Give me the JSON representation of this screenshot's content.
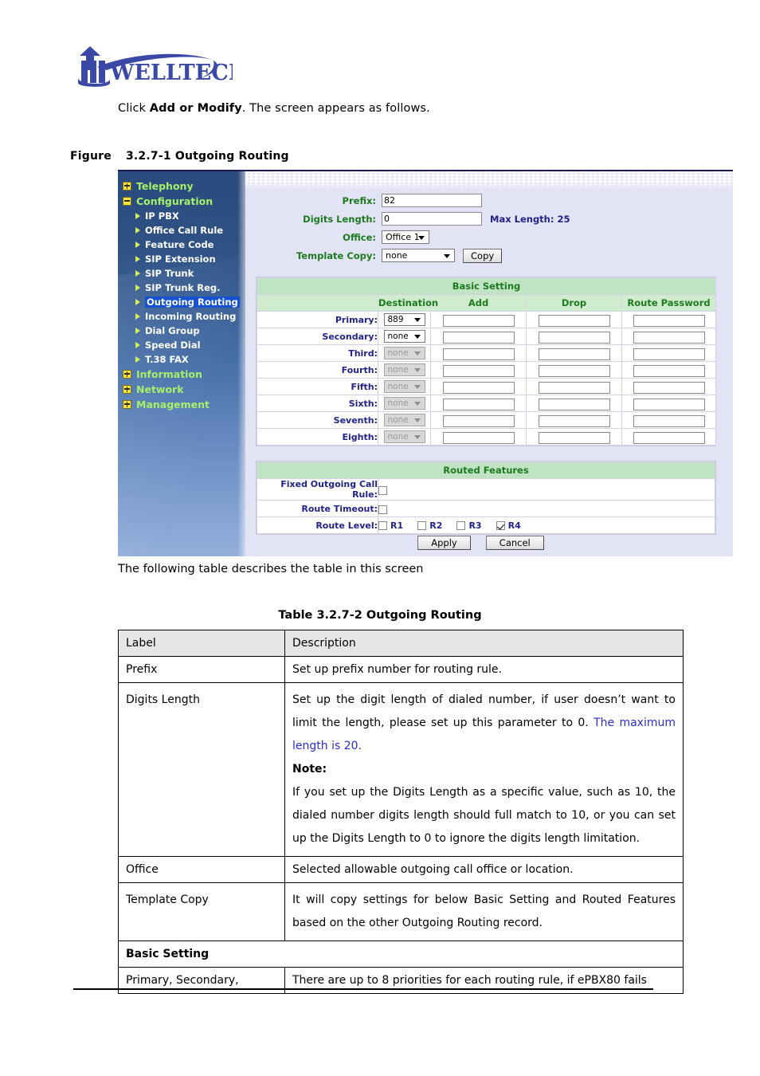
{
  "brand": {
    "name": "WELLTECH",
    "color": "#3a48a6"
  },
  "intro": {
    "before": "Click ",
    "bold": "Add or Modify",
    "after": ". The screen appears as follows."
  },
  "figure": {
    "label": "Figure",
    "caption": "3.2.7-1 Outgoing Routing"
  },
  "after_figure_text": "The following table describes the table in this screen",
  "screenshot": {
    "sidebar": {
      "items": [
        {
          "label": "Telephony",
          "type": "top",
          "state": "collapsed",
          "icon": "plus-box-icon"
        },
        {
          "label": "Configuration",
          "type": "top",
          "state": "expanded",
          "icon": "minus-box-icon"
        },
        {
          "label": "IP PBX",
          "type": "sub",
          "active": false,
          "icon": "arrow-right-icon"
        },
        {
          "label": "Office Call Rule",
          "type": "sub",
          "active": false,
          "icon": "arrow-right-icon"
        },
        {
          "label": "Feature Code",
          "type": "sub",
          "active": false,
          "icon": "arrow-right-icon"
        },
        {
          "label": "SIP Extension",
          "type": "sub",
          "active": false,
          "icon": "arrow-right-icon"
        },
        {
          "label": "SIP Trunk",
          "type": "sub",
          "active": false,
          "icon": "arrow-right-icon"
        },
        {
          "label": "SIP Trunk Reg.",
          "type": "sub",
          "active": false,
          "icon": "arrow-right-icon"
        },
        {
          "label": "Outgoing Routing",
          "type": "sub",
          "active": true,
          "icon": "arrow-right-icon"
        },
        {
          "label": "Incoming Routing",
          "type": "sub",
          "active": false,
          "icon": "arrow-right-icon"
        },
        {
          "label": "Dial Group",
          "type": "sub",
          "active": false,
          "icon": "arrow-right-icon"
        },
        {
          "label": "Speed Dial",
          "type": "sub",
          "active": false,
          "icon": "arrow-right-icon"
        },
        {
          "label": "T.38 FAX",
          "type": "sub",
          "active": false,
          "icon": "arrow-right-icon"
        },
        {
          "label": "Information",
          "type": "top",
          "state": "collapsed",
          "icon": "plus-box-icon"
        },
        {
          "label": "Network",
          "type": "top",
          "state": "collapsed",
          "icon": "plus-box-icon"
        },
        {
          "label": "Management",
          "type": "top",
          "state": "collapsed",
          "icon": "plus-box-icon"
        }
      ]
    },
    "form": {
      "prefix_label": "Prefix:",
      "prefix_value": "82",
      "digits_label": "Digits Length:",
      "digits_value": "0",
      "max_length_note": "Max Length: 25",
      "office_label": "Office:",
      "office_value": "Office 1",
      "template_label": "Template Copy:",
      "template_value": "none",
      "copy_button": "Copy"
    },
    "basic_setting": {
      "title": "Basic Setting",
      "columns": [
        "",
        "Destination",
        "Add",
        "Drop",
        "Route Password"
      ],
      "rows": [
        {
          "label": "Primary:",
          "destination": "889",
          "disabled": false,
          "add": "",
          "drop": "",
          "password": ""
        },
        {
          "label": "Secondary:",
          "destination": "none",
          "disabled": false,
          "add": "",
          "drop": "",
          "password": ""
        },
        {
          "label": "Third:",
          "destination": "none",
          "disabled": true,
          "add": "",
          "drop": "",
          "password": ""
        },
        {
          "label": "Fourth:",
          "destination": "none",
          "disabled": true,
          "add": "",
          "drop": "",
          "password": ""
        },
        {
          "label": "Fifth:",
          "destination": "none",
          "disabled": true,
          "add": "",
          "drop": "",
          "password": ""
        },
        {
          "label": "Sixth:",
          "destination": "none",
          "disabled": true,
          "add": "",
          "drop": "",
          "password": ""
        },
        {
          "label": "Seventh:",
          "destination": "none",
          "disabled": true,
          "add": "",
          "drop": "",
          "password": ""
        },
        {
          "label": "Eighth:",
          "destination": "none",
          "disabled": true,
          "add": "",
          "drop": "",
          "password": ""
        }
      ]
    },
    "routed_features": {
      "title": "Routed Features",
      "fixed_rule_label": "Fixed Outgoing Call Rule:",
      "fixed_rule_checked": false,
      "route_timeout_label": "Route Timeout:",
      "route_timeout_checked": false,
      "route_level_label": "Route Level:",
      "route_levels": [
        {
          "label": "R1",
          "checked": false
        },
        {
          "label": "R2",
          "checked": false
        },
        {
          "label": "R3",
          "checked": false
        },
        {
          "label": "R4",
          "checked": true
        }
      ]
    },
    "buttons": {
      "apply": "Apply",
      "cancel": "Cancel"
    }
  },
  "desc_table": {
    "caption": "Table 3.2.7-2 Outgoing Routing",
    "head": {
      "label": "Label",
      "description": "Description"
    },
    "rows": [
      {
        "label": "Prefix",
        "desc_plain": "Set up prefix number for routing rule."
      },
      {
        "label": "Digits Length",
        "desc_part1": "Set up the digit length of dialed number, if user doesn’t want to limit the length, please set up this parameter to 0. ",
        "desc_blue": "The maximum length is 20.",
        "note_label": "Note:",
        "note_text": "If you set up the Digits Length as a specific value, such as 10, the dialed number digits length should full match to 10, or you can set up the Digits Length to 0 to ignore the digits length limitation."
      },
      {
        "label": "Office",
        "desc_plain": "Selected allowable outgoing call office or location."
      },
      {
        "label": "Template Copy",
        "desc_plain": "It will copy settings for below Basic Setting and Routed Features based on the other Outgoing Routing record."
      }
    ],
    "section_row": "Basic Setting",
    "last_row": {
      "label": "Primary, Secondary,",
      "desc": "There are up to 8 priorities for each routing rule, if ePBX80 fails"
    }
  }
}
